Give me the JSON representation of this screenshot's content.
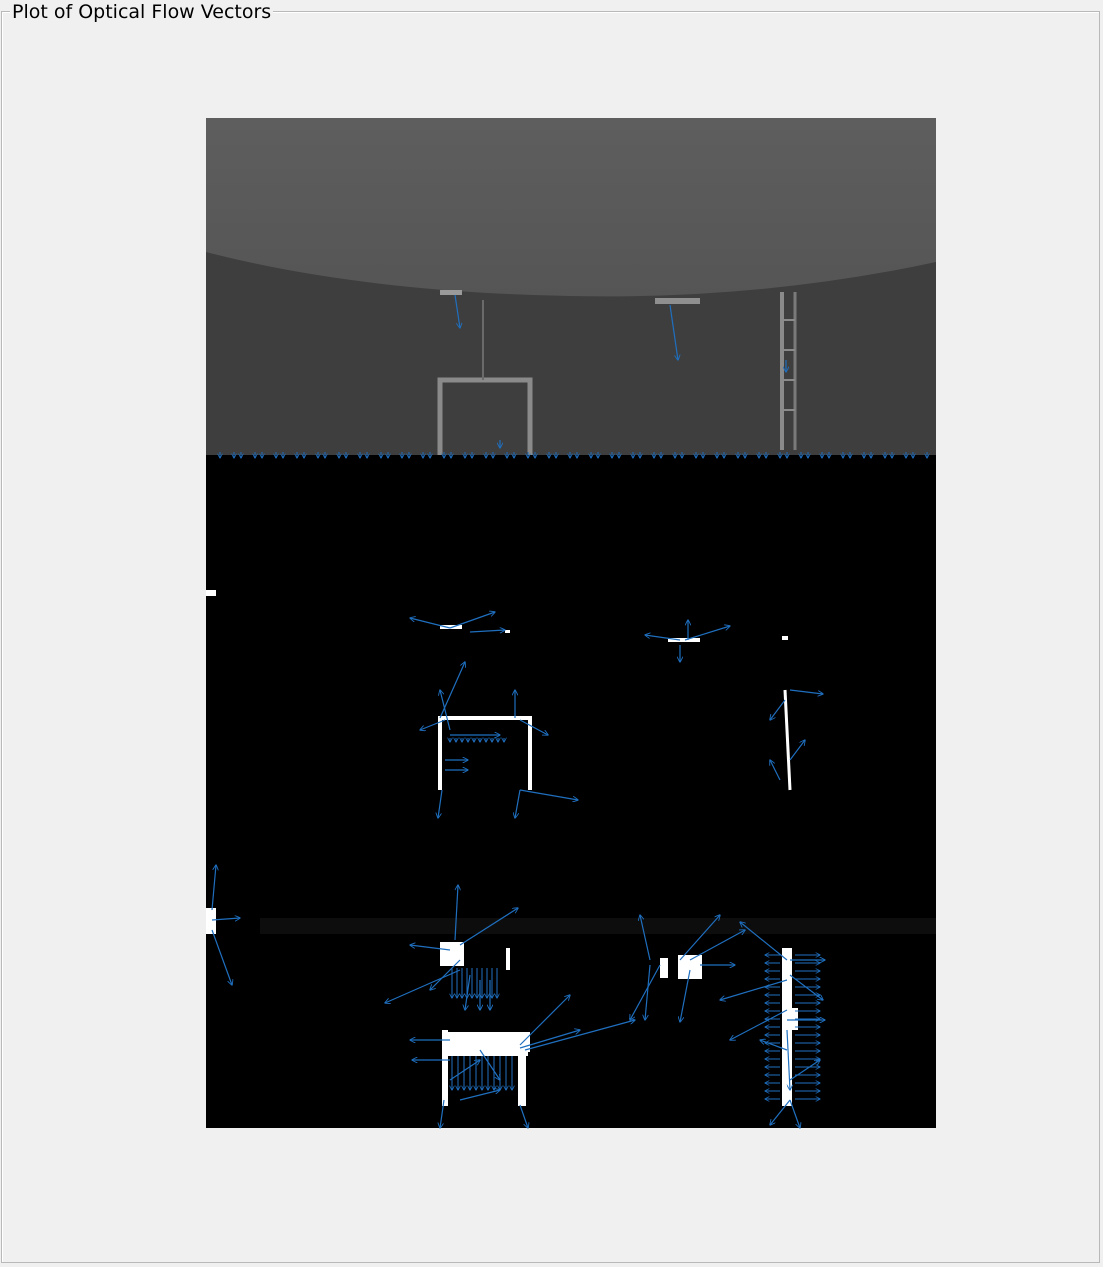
{
  "panel": {
    "title": "Plot of Optical Flow Vectors"
  },
  "colors": {
    "window_background": "#f0f0f0",
    "panel_border": "#b9b9b9",
    "flow_vector": "#1f6fbf",
    "edge_mask": "#ffffff",
    "mask_background": "#000000",
    "camera_frame_ceiling": "#5a5a5a",
    "camera_frame_wall": "#3f3f3f"
  },
  "plot": {
    "type": "image-with-quiver",
    "description_icon": "optical-flow-plot",
    "frames": [
      {
        "name": "grayscale-camera-frame"
      },
      {
        "name": "binary-edge-mask-frame"
      }
    ],
    "vector_style": "arrows"
  }
}
